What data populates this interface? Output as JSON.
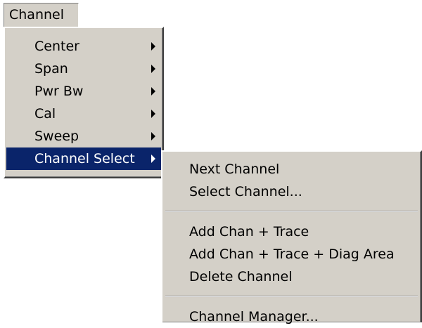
{
  "menubar": {
    "label": "Channel"
  },
  "channel_menu": {
    "items": [
      {
        "label": "Center",
        "submenu": true
      },
      {
        "label": "Span",
        "submenu": true
      },
      {
        "label": "Pwr Bw",
        "submenu": true
      },
      {
        "label": "Cal",
        "submenu": true
      },
      {
        "label": "Sweep",
        "submenu": true
      },
      {
        "label": "Channel Select",
        "submenu": true,
        "selected": true
      }
    ]
  },
  "channel_select_menu": {
    "items": [
      "Next Channel",
      "Select Channel...",
      "Add Chan + Trace",
      "Add Chan + Trace + Diag Area",
      "Delete Channel",
      "Channel Manager..."
    ]
  },
  "colors": {
    "menu_background": "#d4d0c8",
    "selection_background": "#0a246a",
    "selection_text": "#ffffff"
  }
}
